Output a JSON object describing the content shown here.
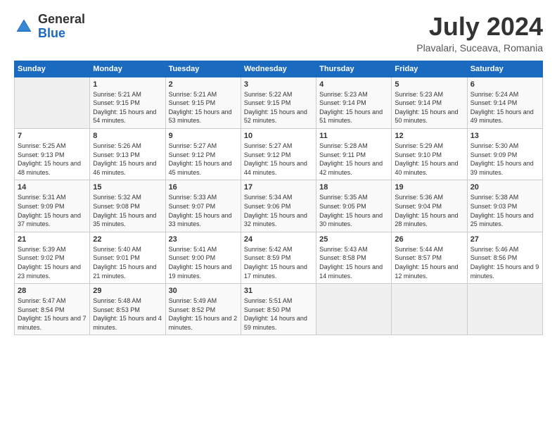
{
  "header": {
    "logo_general": "General",
    "logo_blue": "Blue",
    "month_title": "July 2024",
    "location": "Plavalari, Suceava, Romania"
  },
  "weekdays": [
    "Sunday",
    "Monday",
    "Tuesday",
    "Wednesday",
    "Thursday",
    "Friday",
    "Saturday"
  ],
  "weeks": [
    [
      {
        "day": "",
        "info": ""
      },
      {
        "day": "1",
        "info": "Sunrise: 5:21 AM\nSunset: 9:15 PM\nDaylight: 15 hours\nand 54 minutes."
      },
      {
        "day": "2",
        "info": "Sunrise: 5:21 AM\nSunset: 9:15 PM\nDaylight: 15 hours\nand 53 minutes."
      },
      {
        "day": "3",
        "info": "Sunrise: 5:22 AM\nSunset: 9:15 PM\nDaylight: 15 hours\nand 52 minutes."
      },
      {
        "day": "4",
        "info": "Sunrise: 5:23 AM\nSunset: 9:14 PM\nDaylight: 15 hours\nand 51 minutes."
      },
      {
        "day": "5",
        "info": "Sunrise: 5:23 AM\nSunset: 9:14 PM\nDaylight: 15 hours\nand 50 minutes."
      },
      {
        "day": "6",
        "info": "Sunrise: 5:24 AM\nSunset: 9:14 PM\nDaylight: 15 hours\nand 49 minutes."
      }
    ],
    [
      {
        "day": "7",
        "info": "Sunrise: 5:25 AM\nSunset: 9:13 PM\nDaylight: 15 hours\nand 48 minutes."
      },
      {
        "day": "8",
        "info": "Sunrise: 5:26 AM\nSunset: 9:13 PM\nDaylight: 15 hours\nand 46 minutes."
      },
      {
        "day": "9",
        "info": "Sunrise: 5:27 AM\nSunset: 9:12 PM\nDaylight: 15 hours\nand 45 minutes."
      },
      {
        "day": "10",
        "info": "Sunrise: 5:27 AM\nSunset: 9:12 PM\nDaylight: 15 hours\nand 44 minutes."
      },
      {
        "day": "11",
        "info": "Sunrise: 5:28 AM\nSunset: 9:11 PM\nDaylight: 15 hours\nand 42 minutes."
      },
      {
        "day": "12",
        "info": "Sunrise: 5:29 AM\nSunset: 9:10 PM\nDaylight: 15 hours\nand 40 minutes."
      },
      {
        "day": "13",
        "info": "Sunrise: 5:30 AM\nSunset: 9:09 PM\nDaylight: 15 hours\nand 39 minutes."
      }
    ],
    [
      {
        "day": "14",
        "info": "Sunrise: 5:31 AM\nSunset: 9:09 PM\nDaylight: 15 hours\nand 37 minutes."
      },
      {
        "day": "15",
        "info": "Sunrise: 5:32 AM\nSunset: 9:08 PM\nDaylight: 15 hours\nand 35 minutes."
      },
      {
        "day": "16",
        "info": "Sunrise: 5:33 AM\nSunset: 9:07 PM\nDaylight: 15 hours\nand 33 minutes."
      },
      {
        "day": "17",
        "info": "Sunrise: 5:34 AM\nSunset: 9:06 PM\nDaylight: 15 hours\nand 32 minutes."
      },
      {
        "day": "18",
        "info": "Sunrise: 5:35 AM\nSunset: 9:05 PM\nDaylight: 15 hours\nand 30 minutes."
      },
      {
        "day": "19",
        "info": "Sunrise: 5:36 AM\nSunset: 9:04 PM\nDaylight: 15 hours\nand 28 minutes."
      },
      {
        "day": "20",
        "info": "Sunrise: 5:38 AM\nSunset: 9:03 PM\nDaylight: 15 hours\nand 25 minutes."
      }
    ],
    [
      {
        "day": "21",
        "info": "Sunrise: 5:39 AM\nSunset: 9:02 PM\nDaylight: 15 hours\nand 23 minutes."
      },
      {
        "day": "22",
        "info": "Sunrise: 5:40 AM\nSunset: 9:01 PM\nDaylight: 15 hours\nand 21 minutes."
      },
      {
        "day": "23",
        "info": "Sunrise: 5:41 AM\nSunset: 9:00 PM\nDaylight: 15 hours\nand 19 minutes."
      },
      {
        "day": "24",
        "info": "Sunrise: 5:42 AM\nSunset: 8:59 PM\nDaylight: 15 hours\nand 17 minutes."
      },
      {
        "day": "25",
        "info": "Sunrise: 5:43 AM\nSunset: 8:58 PM\nDaylight: 15 hours\nand 14 minutes."
      },
      {
        "day": "26",
        "info": "Sunrise: 5:44 AM\nSunset: 8:57 PM\nDaylight: 15 hours\nand 12 minutes."
      },
      {
        "day": "27",
        "info": "Sunrise: 5:46 AM\nSunset: 8:56 PM\nDaylight: 15 hours\nand 9 minutes."
      }
    ],
    [
      {
        "day": "28",
        "info": "Sunrise: 5:47 AM\nSunset: 8:54 PM\nDaylight: 15 hours\nand 7 minutes."
      },
      {
        "day": "29",
        "info": "Sunrise: 5:48 AM\nSunset: 8:53 PM\nDaylight: 15 hours\nand 4 minutes."
      },
      {
        "day": "30",
        "info": "Sunrise: 5:49 AM\nSunset: 8:52 PM\nDaylight: 15 hours\nand 2 minutes."
      },
      {
        "day": "31",
        "info": "Sunrise: 5:51 AM\nSunset: 8:50 PM\nDaylight: 14 hours\nand 59 minutes."
      },
      {
        "day": "",
        "info": ""
      },
      {
        "day": "",
        "info": ""
      },
      {
        "day": "",
        "info": ""
      }
    ]
  ]
}
